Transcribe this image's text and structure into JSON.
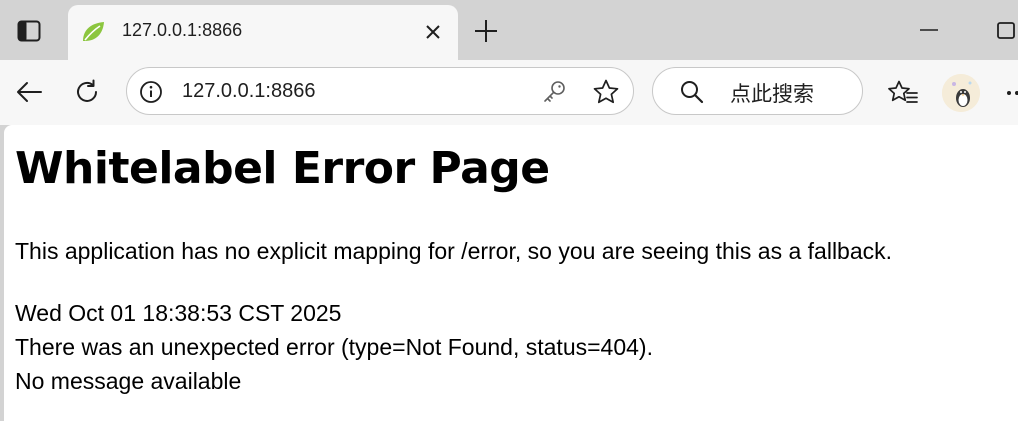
{
  "browser": {
    "tab": {
      "title": "127.0.0.1:8866"
    },
    "address_bar": {
      "url": "127.0.0.1:8866"
    },
    "search_box": {
      "placeholder": "点此搜索"
    },
    "colors": {
      "tab_strip": "#d3d3d3",
      "toolbar": "#f7f7f7",
      "favicon_green": "#8cc63f",
      "page_background": "#ffffff"
    },
    "icons": [
      "sidebar-toggle-icon",
      "spring-leaf-icon",
      "close-icon",
      "plus-icon",
      "minimize-icon",
      "restore-icon",
      "back-arrow-icon",
      "refresh-icon",
      "info-icon",
      "key-icon",
      "star-icon",
      "search-icon",
      "favorites-icon",
      "avatar",
      "more-icon"
    ]
  },
  "page": {
    "title": "Whitelabel Error Page",
    "description": "This application has no explicit mapping for /error, so you are seeing this as a fallback.",
    "timestamp": "Wed Oct 01 18:38:53 CST 2025",
    "error_line": "There was an unexpected error (type=Not Found, status=404).",
    "message_line": "No message available"
  }
}
